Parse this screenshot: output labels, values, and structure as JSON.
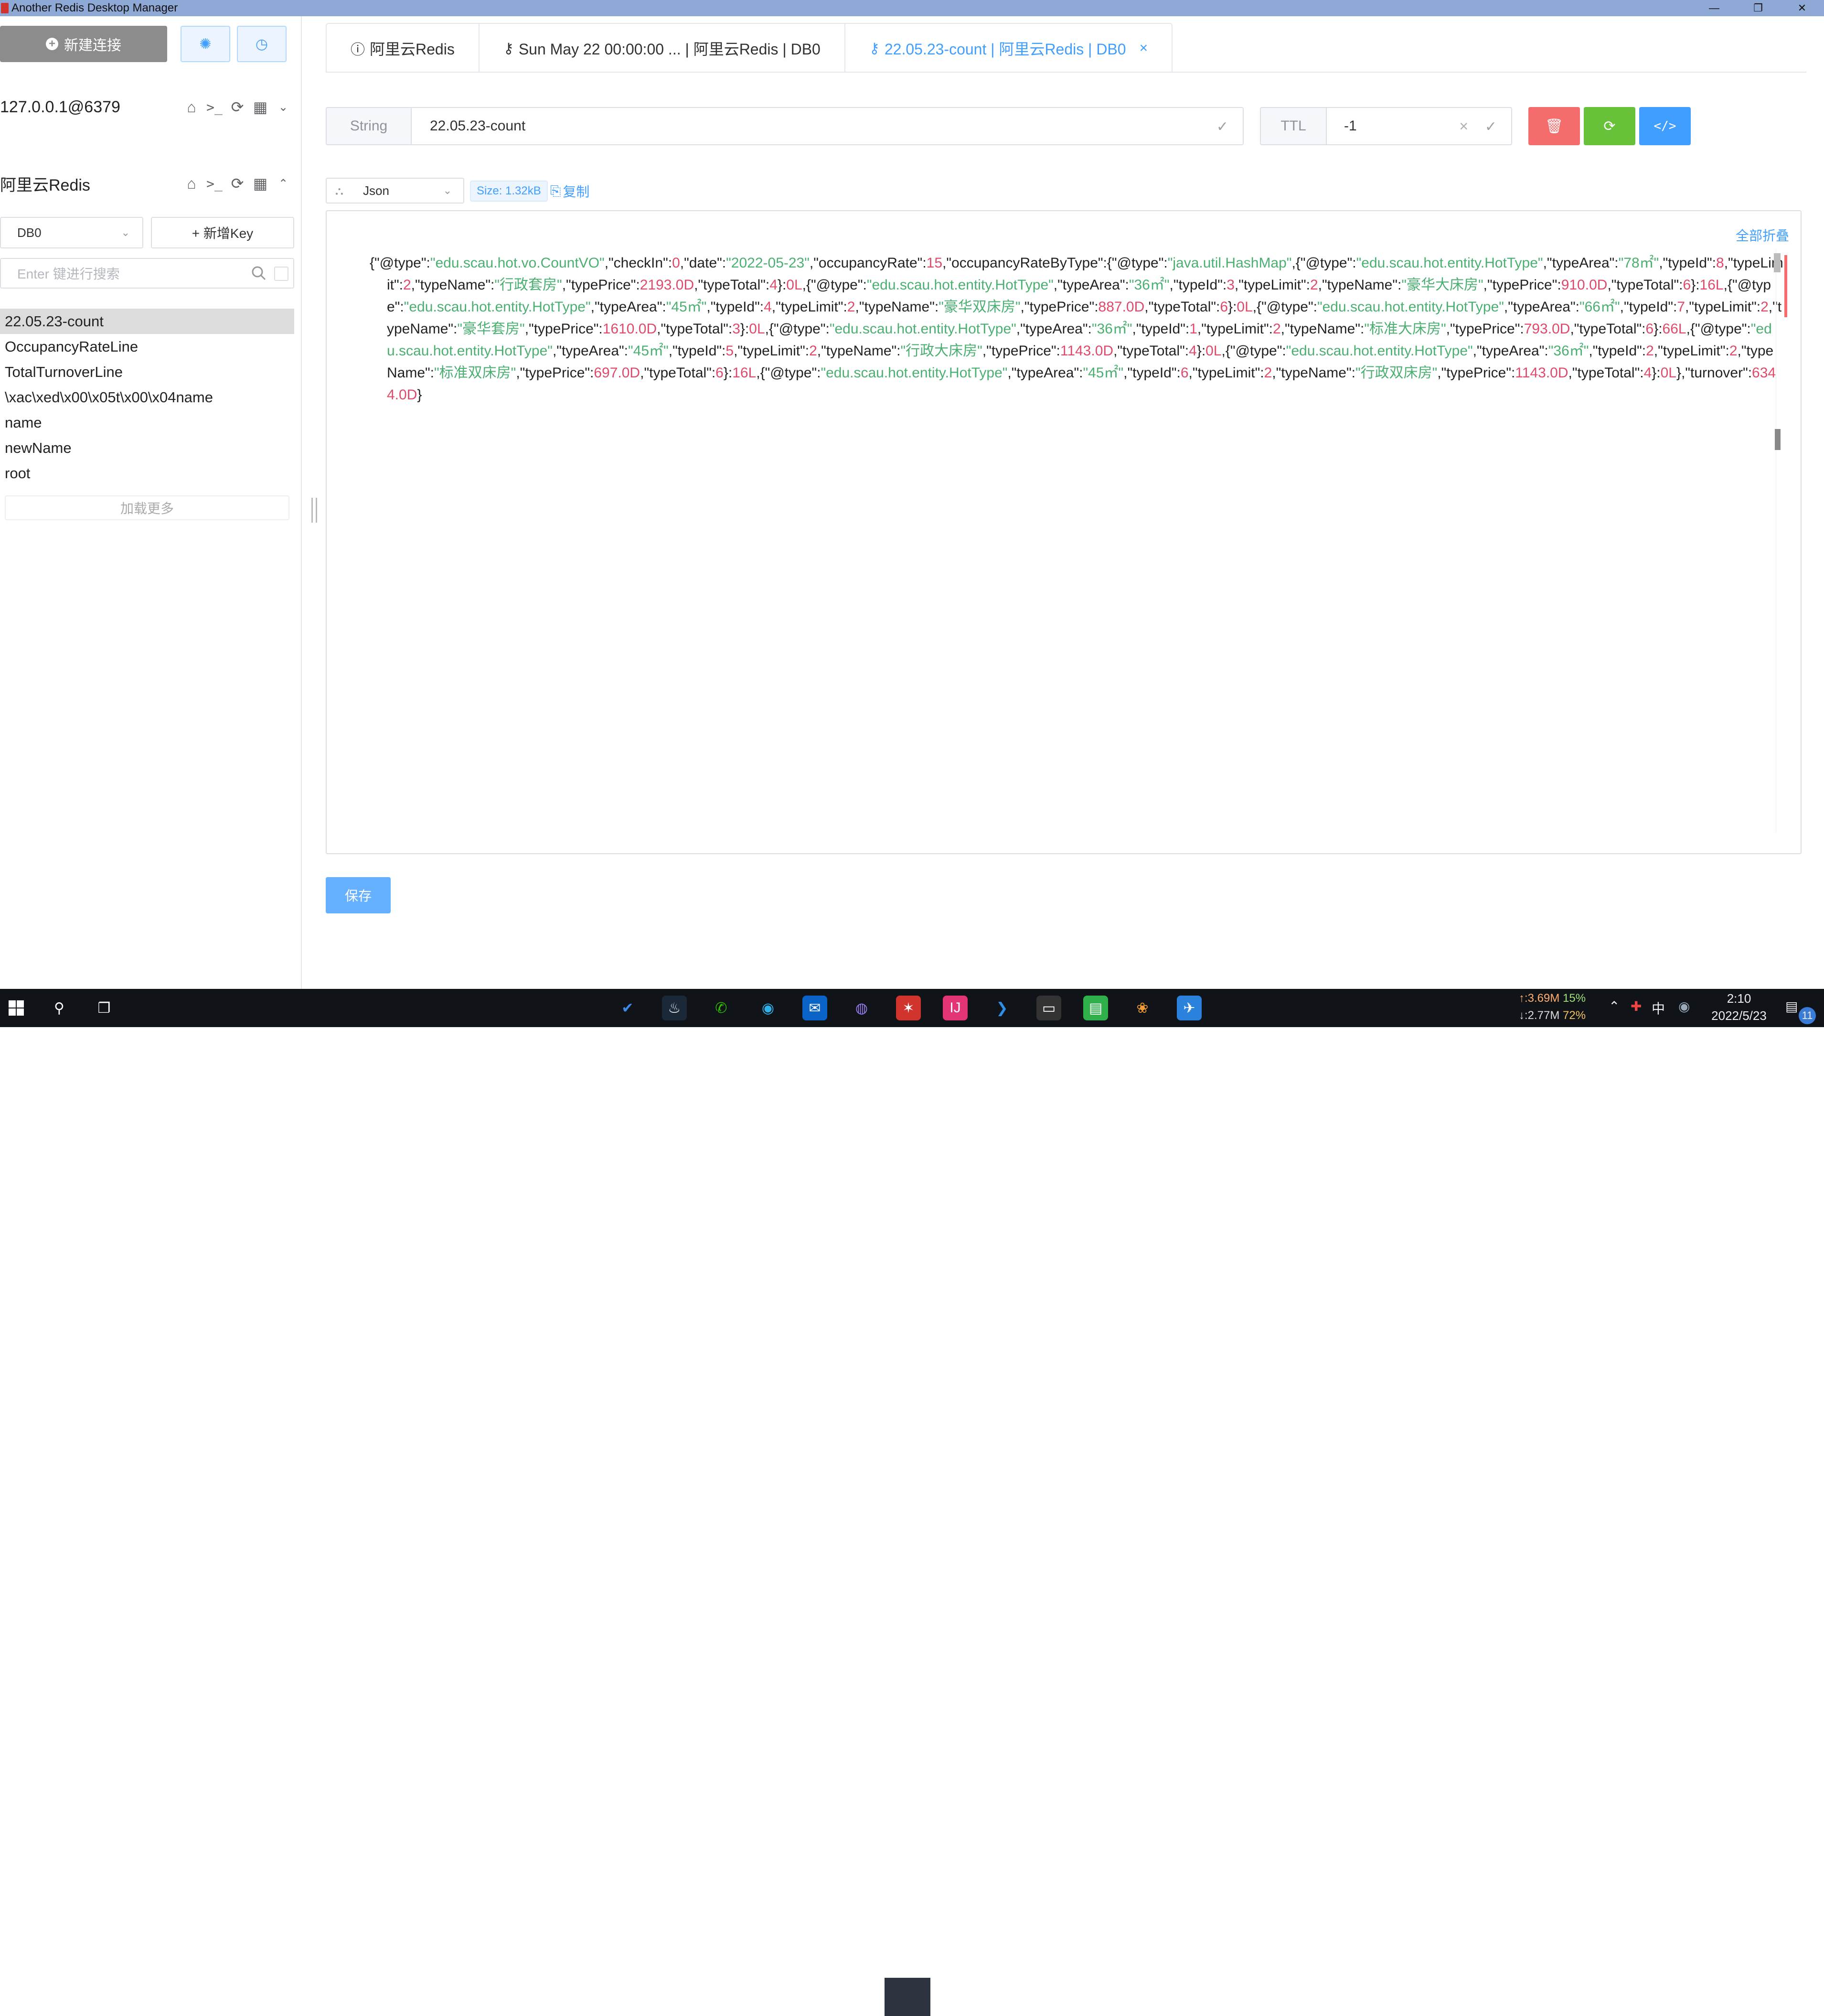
{
  "window": {
    "title": "Another Redis Desktop Manager",
    "controls": [
      "—",
      "❐",
      "✕"
    ]
  },
  "sidebar": {
    "new_connection": "新建连接",
    "connections": [
      {
        "name": "127.0.0.1@6379",
        "expanded": false
      },
      {
        "name": "阿里云Redis",
        "expanded": true
      }
    ],
    "db_select": "DB0",
    "new_key": "+ 新增Key",
    "search_placeholder": "Enter 键进行搜索",
    "keys": [
      "22.05.23-count",
      "OccupancyRateLine",
      "TotalTurnoverLine",
      "\\xac\\xed\\x00\\x05t\\x00\\x04name",
      "name",
      "newName",
      "root"
    ],
    "load_more": "加载更多"
  },
  "tabs": [
    {
      "label": "阿里云Redis",
      "icon": "info-icon",
      "active": false
    },
    {
      "label": "Sun May 22 00:00:00 ... | 阿里云Redis | DB0",
      "icon": "key-icon",
      "active": false
    },
    {
      "label": "22.05.23-count | 阿里云Redis | DB0",
      "icon": "key-icon",
      "active": true,
      "closable": true
    }
  ],
  "key_editor": {
    "type": "String",
    "key_name": "22.05.23-count",
    "ttl_label": "TTL",
    "ttl_value": "-1",
    "format": "Json",
    "size": "Size: 1.32kB",
    "copy": "复制",
    "collapse_all": "全部折叠",
    "save": "保存"
  },
  "json_value": "{\"@type\":\"edu.scau.hot.vo.CountVO\",\"checkIn\":0,\"date\":\"2022-05-23\",\"occupancyRate\":15,\"occupancyRateByType\":{\"@type\":\"java.util.HashMap\",{\"@type\":\"edu.scau.hot.entity.HotType\",\"typeArea\":\"78㎡\",\"typeId\":8,\"typeLimit\":2,\"typeName\":\"行政套房\",\"typePrice\":2193.0D,\"typeTotal\":4}:0L,{\"@type\":\"edu.scau.hot.entity.HotType\",\"typeArea\":\"36㎡\",\"typeId\":3,\"typeLimit\":2,\"typeName\":\"豪华大床房\",\"typePrice\":910.0D,\"typeTotal\":6}:16L,{\"@type\":\"edu.scau.hot.entity.HotType\",\"typeArea\":\"45㎡\",\"typeId\":4,\"typeLimit\":2,\"typeName\":\"豪华双床房\",\"typePrice\":887.0D,\"typeTotal\":6}:0L,{\"@type\":\"edu.scau.hot.entity.HotType\",\"typeArea\":\"66㎡\",\"typeId\":7,\"typeLimit\":2,\"typeName\":\"豪华套房\",\"typePrice\":1610.0D,\"typeTotal\":3}:0L,{\"@type\":\"edu.scau.hot.entity.HotType\",\"typeArea\":\"36㎡\",\"typeId\":1,\"typeLimit\":2,\"typeName\":\"标准大床房\",\"typePrice\":793.0D,\"typeTotal\":6}:66L,{\"@type\":\"edu.scau.hot.entity.HotType\",\"typeArea\":\"45㎡\",\"typeId\":5,\"typeLimit\":2,\"typeName\":\"行政大床房\",\"typePrice\":1143.0D,\"typeTotal\":4}:0L,{\"@type\":\"edu.scau.hot.entity.HotType\",\"typeArea\":\"36㎡\",\"typeId\":2,\"typeLimit\":2,\"typeName\":\"标准双床房\",\"typePrice\":697.0D,\"typeTotal\":6}:16L,{\"@type\":\"edu.scau.hot.entity.HotType\",\"typeArea\":\"45㎡\",\"typeId\":6,\"typeLimit\":2,\"typeName\":\"行政双床房\",\"typePrice\":1143.0D,\"typeTotal\":4}:0L},\"turnover\":6344.0D}",
  "taskbar": {
    "net_up": "↑:3.69M",
    "net_up_pct": "15%",
    "net_down": "↓:2.77M",
    "net_down_pct": "72%",
    "ime": "中",
    "time": "2:10",
    "date": "2022/5/23",
    "notifications": "11"
  },
  "colors": {
    "primary": "#409eff",
    "danger": "#f56c6c",
    "success": "#67c23a",
    "json_string": "#4caf72",
    "json_number": "#e04a6a"
  }
}
